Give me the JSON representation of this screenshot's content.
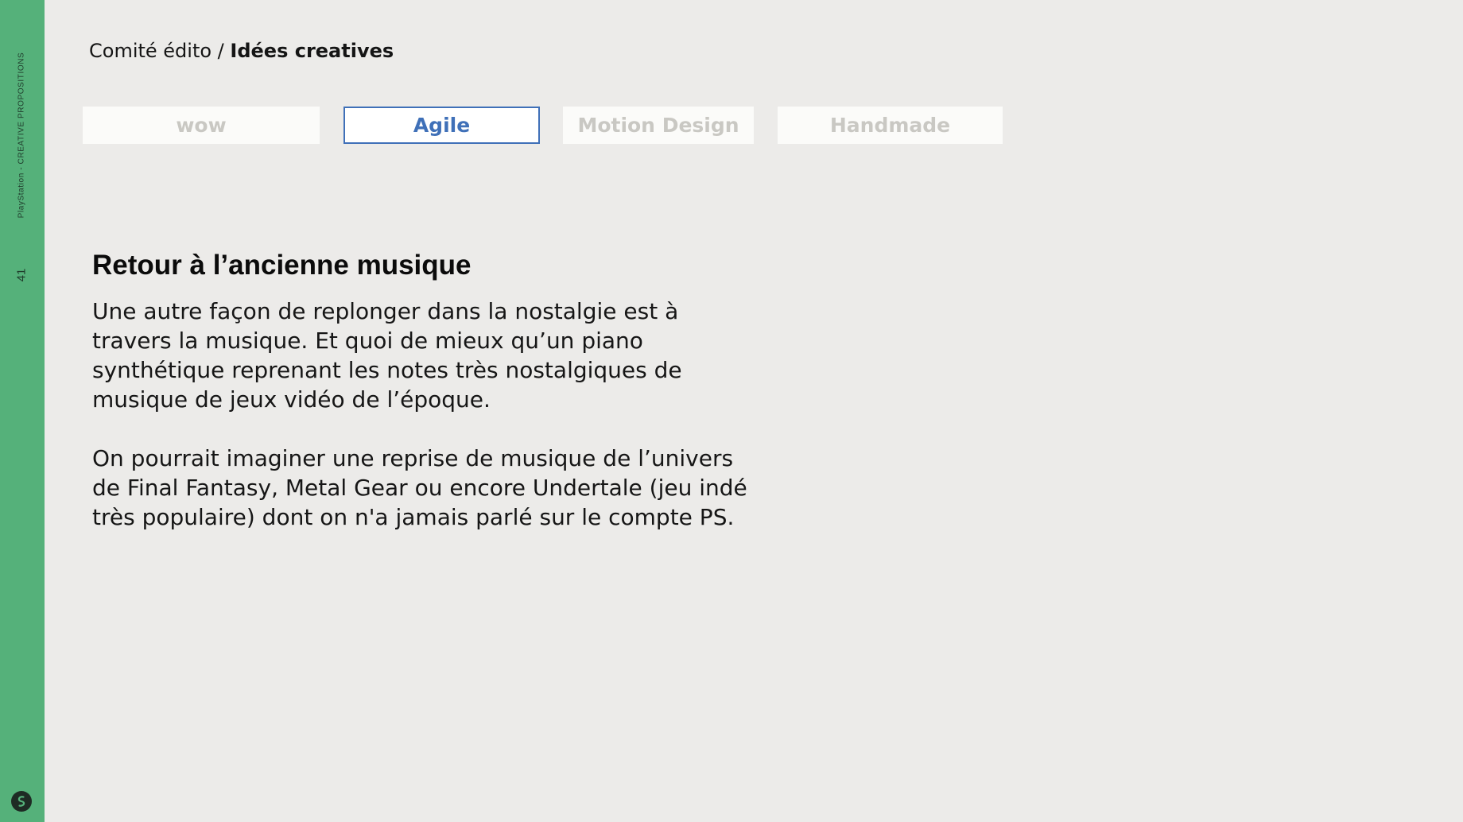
{
  "sidebar": {
    "caption": "PlayStation - CREATIVE PROPOSITIONS",
    "page_number": "41",
    "logo_icon": "brand-swirl-icon",
    "color": "#55b17a"
  },
  "breadcrumb": {
    "section": "Comité édito / ",
    "current": "Idées creatives"
  },
  "tags": [
    {
      "label": "wow",
      "selected": false
    },
    {
      "label": "Agile",
      "selected": true
    },
    {
      "label": "Motion Design",
      "selected": false
    },
    {
      "label": "Handmade",
      "selected": false
    }
  ],
  "colors": {
    "selected_tag": "#3f70b8",
    "inactive_tag_text": "#c9c8c3",
    "background": "#ecebe9"
  },
  "content": {
    "title": "Retour à l’ancienne musique",
    "paragraphs": [
      "Une autre façon de replonger dans la nostalgie est à travers la musique. Et quoi de mieux qu’un piano synthétique reprenant les notes très nostalgiques de musique de jeux vidéo de l’époque.",
      "On pourrait imaginer une reprise de musique de l’univers de Final Fantasy, Metal Gear ou encore Undertale (jeu indé très populaire) dont on n'a jamais parlé sur le compte PS."
    ]
  }
}
